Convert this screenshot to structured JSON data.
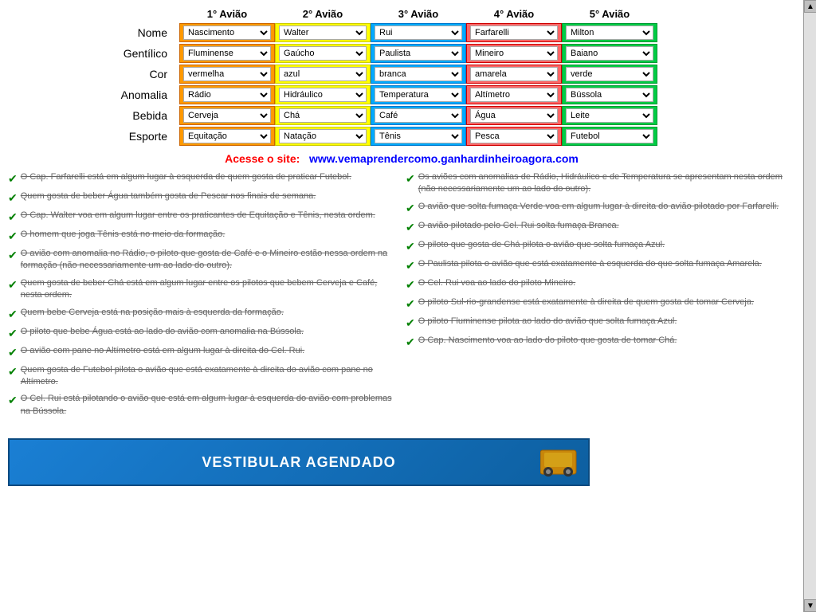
{
  "headers": {
    "aviao1": "1° Avião",
    "aviao2": "2° Avião",
    "aviao3": "3° Avião",
    "aviao4": "4° Avião",
    "aviao5": "5° Avião"
  },
  "rows": [
    {
      "label": "Nome",
      "col1": "Nascimento",
      "col2": "Walter",
      "col3": "Rui",
      "col4": "Farfarelli",
      "col5": "Milton"
    },
    {
      "label": "Gentílico",
      "col1": "Fluminense",
      "col2": "Gaúcho",
      "col3": "Paulista",
      "col4": "Mineiro",
      "col5": "Baiano"
    },
    {
      "label": "Cor",
      "col1": "vermelha",
      "col2": "azul",
      "col3": "branca",
      "col4": "amarela",
      "col5": "verde"
    },
    {
      "label": "Anomalia",
      "col1": "Rádio",
      "col2": "Hidráulico",
      "col3": "Temperatura",
      "col4": "Altímetro",
      "col5": "Bússola"
    },
    {
      "label": "Bebida",
      "col1": "Cerveja",
      "col2": "Chá",
      "col3": "Café",
      "col4": "Água",
      "col5": "Leite"
    },
    {
      "label": "Esporte",
      "col1": "Equitação",
      "col2": "Natação",
      "col3": "Tênis",
      "col4": "Pesca",
      "col5": "Futebol"
    }
  ],
  "promo": {
    "acesse": "Acesse o site:",
    "url": "www.vemaprendercomo.ganhardinheiroagora.com"
  },
  "clues_left": [
    "O Cap. Farfarelli está em algum lugar à esquerda de quem gosta de praticar Futebol.",
    "Quem gosta de beber Água também gosta de Pescar nos finais de semana.",
    "O Cap. Walter voa em algum lugar entre os praticantes de Equitação e Tênis, nesta ordem.",
    "O homem que joga Tênis está no meio da formação.",
    "O avião com anomalia no Rádio, o piloto que gosta de Café e o Mineiro estão nessa ordem na formação (não necessariamente um ao lado do outro).",
    "Quem gosta de beber Chá está em algum lugar entre os pilotos que bebem Cerveja e Café, nesta ordem.",
    "Quem bebe Cerveja está na posição mais à esquerda da formação.",
    "O piloto que bebe Água está ao lado do avião com anomalia na Bússola.",
    "O avião com pane no Altímetro está em algum lugar à direita do Cel. Rui.",
    "Quem gosta de Futebol pilota o avião que está exatamente à direita do avião com pane no Altímetro.",
    "O Cel. Rui está pilotando o avião que está em algum lugar à esquerda do avião com problemas na Bússola."
  ],
  "clues_right": [
    "Os aviões com anomalias de Rádio, Hidráulico e de Temperatura se apresentam nesta ordem (não necessariamente um ao lado do outro).",
    "O avião que solta fumaça Verde voa em algum lugar à direita do avião pilotado por Farfarelli.",
    "O avião pilotado pelo Cel. Rui solta fumaça Branca.",
    "O piloto que gosta de Chá pilota o avião que solta fumaça Azul.",
    "O Paulista pilota o avião que está exatamente à esquerda do que solta fumaça Amarela.",
    "O Cel. Rui voa ao lado do piloto Mineiro.",
    "O piloto Sul-rio-grandense está exatamente à direita de quem gosta de tomar Cerveja.",
    "O piloto Fluminense pilota ao lado do avião que solta fumaça Azul.",
    "O Cap. Nascimento voa ao lado do piloto que gosta de tomar Chá."
  ],
  "banner": {
    "text": "VESTIBULAR AGENDADO"
  }
}
